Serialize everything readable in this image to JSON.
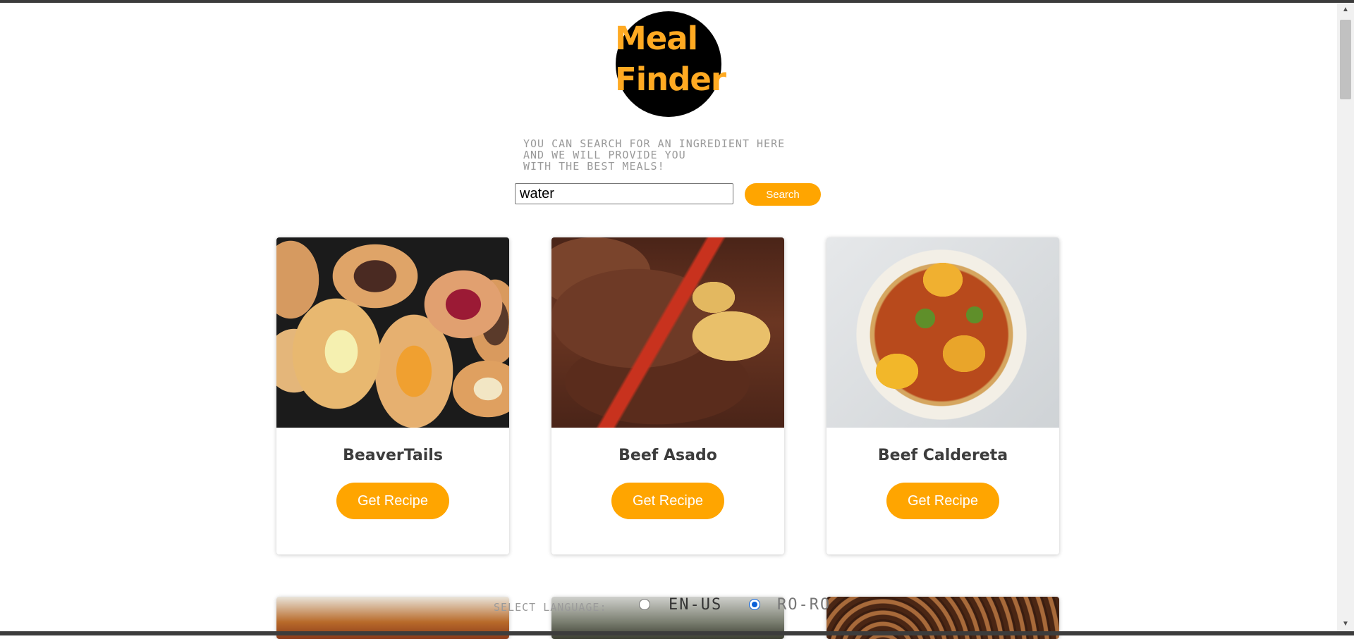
{
  "logo": {
    "line1": "Meal",
    "line2": "Finder"
  },
  "search": {
    "hint": "YOU CAN SEARCH FOR AN INGREDIENT HERE\nAND WE WILL PROVIDE YOU\nWITH THE BEST MEALS!",
    "value": "water",
    "button_label": "Search"
  },
  "meals": [
    {
      "name": "BeaverTails",
      "button": "Get Recipe"
    },
    {
      "name": "Beef Asado",
      "button": "Get Recipe"
    },
    {
      "name": "Beef Caldereta",
      "button": "Get Recipe"
    }
  ],
  "language": {
    "label": "SELECT LANGUAGE:",
    "options": [
      {
        "label": "EN-US",
        "selected": false
      },
      {
        "label": "RO-RO",
        "selected": true
      }
    ]
  },
  "colors": {
    "accent": "#ffa500",
    "logo_bg": "#000000",
    "logo_text": "#ffaa22"
  }
}
